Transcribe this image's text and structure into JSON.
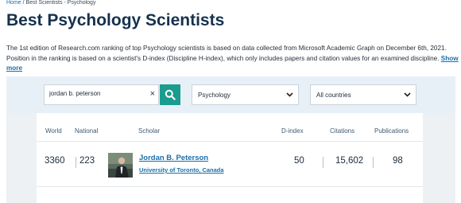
{
  "breadcrumb": {
    "home": "Home",
    "separator": " / ",
    "current": "Best Scientists - Psychology"
  },
  "page": {
    "title": "Best Psychology Scientists",
    "intro": "The 1st edition of Research.com ranking of top Psychology scientists is based on data collected from Microsoft Academic Graph on December 6th, 2021. Position in the ranking is based on a scientist's D-index (Discipline H-index), which only includes papers and citation values for an examined discipline.",
    "show_more": "Show more"
  },
  "search": {
    "value": "jordan b. peterson",
    "clear_symbol": "×",
    "icon": "search-icon"
  },
  "filters": {
    "field_selected": "Psychology",
    "country_selected": "All countries",
    "icon": "chevron-down-icon"
  },
  "table": {
    "headers": {
      "world": "World",
      "national": "National",
      "scholar": "Scholar",
      "dindex": "D-index",
      "citations": "Citations",
      "publications": "Publications"
    },
    "rows": [
      {
        "world": "3360",
        "national": "223",
        "name": "Jordan B. Peterson",
        "affiliation": "University of Toronto, Canada",
        "dindex": "50",
        "citations": "15,602",
        "publications": "98"
      }
    ]
  },
  "colors": {
    "title": "#15324e",
    "link": "#1a6fa8",
    "accent": "#1a9c8e",
    "panel": "#edf1f4"
  }
}
